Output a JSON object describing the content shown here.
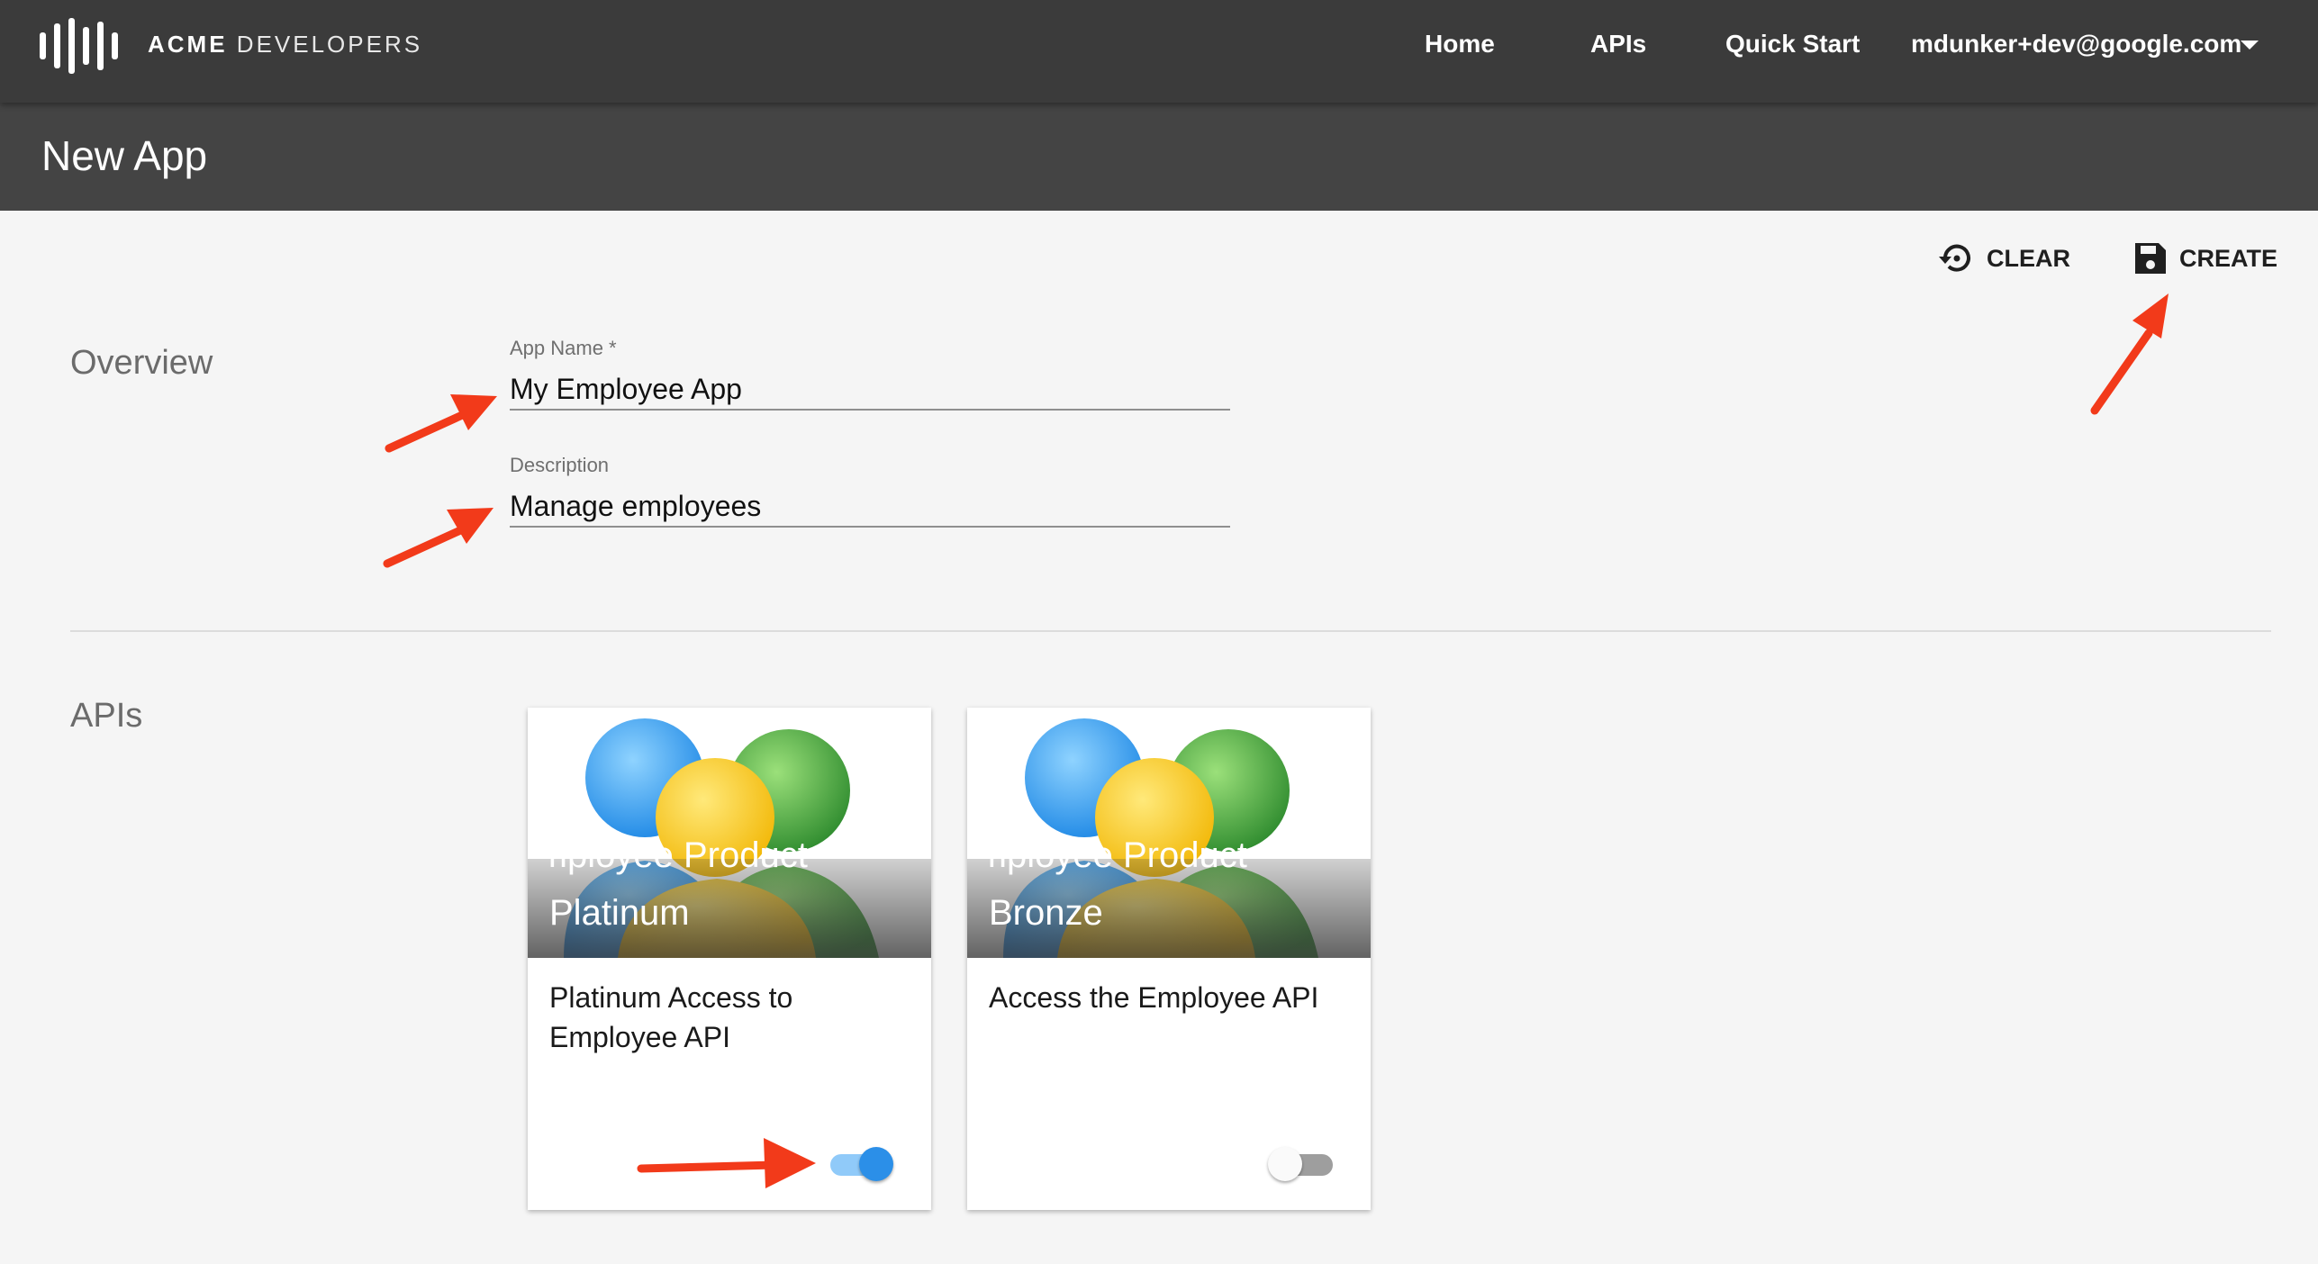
{
  "nav": {
    "brand_bold": "ACME",
    "brand_light": "DEVELOPERS",
    "items": [
      {
        "label": "Home"
      },
      {
        "label": "APIs"
      },
      {
        "label": "Quick Start"
      }
    ],
    "user_email": "mdunker+dev@google.com"
  },
  "header": {
    "title": "New App"
  },
  "actions": {
    "clear_label": "CLEAR",
    "create_label": "CREATE"
  },
  "overview": {
    "section_label": "Overview",
    "app_name": {
      "label": "App Name *",
      "value": "My Employee App"
    },
    "description": {
      "label": "Description",
      "value": "Manage employees"
    }
  },
  "apis": {
    "section_label": "APIs",
    "cards": [
      {
        "title_line1": "Employee Product -",
        "title_line2": "Platinum",
        "description": "Platinum Access to Employee API",
        "enabled": true
      },
      {
        "title_line1": "Employee Product -",
        "title_line2": "Bronze",
        "description": "Access the Employee API",
        "enabled": false
      }
    ]
  },
  "colors": {
    "topbar": "#3b3b3b",
    "subheader": "#444444",
    "toggle_on": "#2b8fe8",
    "annotation_arrow": "#f23a1a"
  }
}
